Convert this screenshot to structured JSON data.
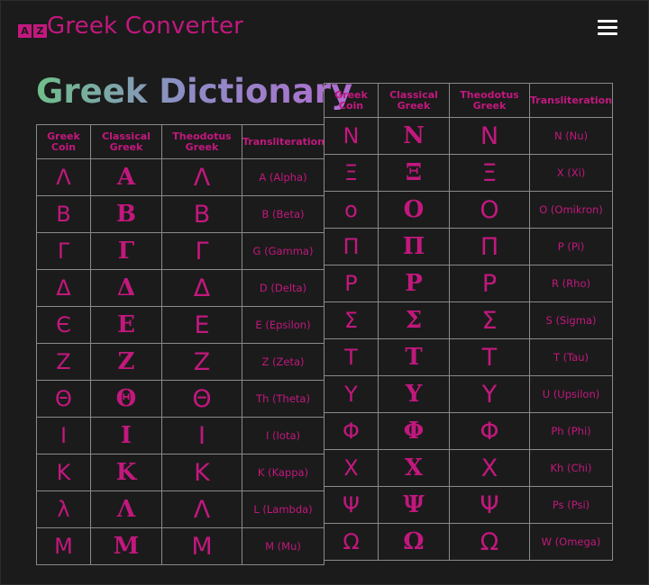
{
  "app": {
    "title": "Greek Converter",
    "logo_glyphs": [
      "A",
      "Ζ"
    ]
  },
  "menu_icon": "hamburger-menu-icon",
  "page": {
    "heading": "Greek Dictionary"
  },
  "colors": {
    "accent": "#c2187e",
    "background": "#1b1b1b",
    "border": "#8a8a8a"
  },
  "table": {
    "headers": [
      "Greek Coin",
      "Classical Greek",
      "Theodotus Greek",
      "Transliteration"
    ],
    "left_rows": [
      {
        "coin": "Λ",
        "classical": "Α",
        "theodotus": "Λ",
        "translit": "A (Alpha)"
      },
      {
        "coin": "Β",
        "classical": "Β",
        "theodotus": "Β",
        "translit": "B (Beta)"
      },
      {
        "coin": "Γ",
        "classical": "Γ",
        "theodotus": "Γ",
        "translit": "G (Gamma)"
      },
      {
        "coin": "Δ",
        "classical": "Δ",
        "theodotus": "Δ",
        "translit": "D (Delta)"
      },
      {
        "coin": "Є",
        "classical": "Ε",
        "theodotus": "Ε",
        "translit": "E (Epsilon)"
      },
      {
        "coin": "Ζ",
        "classical": "Ζ",
        "theodotus": "Ζ",
        "translit": "Z (Zeta)"
      },
      {
        "coin": "Θ",
        "classical": "Θ",
        "theodotus": "Θ",
        "translit": "Th (Theta)"
      },
      {
        "coin": "Ι",
        "classical": "Ι",
        "theodotus": "Ι",
        "translit": "I (Iota)"
      },
      {
        "coin": "Κ",
        "classical": "Κ",
        "theodotus": "Κ",
        "translit": "K (Kappa)"
      },
      {
        "coin": "λ",
        "classical": "Λ",
        "theodotus": "Λ",
        "translit": "L (Lambda)"
      },
      {
        "coin": "Μ",
        "classical": "Μ",
        "theodotus": "Μ",
        "translit": "M (Mu)"
      }
    ],
    "right_rows": [
      {
        "coin": "Ν",
        "classical": "Ν",
        "theodotus": "Ν",
        "translit": "N (Nu)"
      },
      {
        "coin": "Ξ",
        "classical": "Ξ",
        "theodotus": "Ξ",
        "translit": "X (Xi)"
      },
      {
        "coin": "ο",
        "classical": "Ο",
        "theodotus": "Ο",
        "translit": "O (Omikron)"
      },
      {
        "coin": "Π",
        "classical": "Π",
        "theodotus": "Π",
        "translit": "P (Pi)"
      },
      {
        "coin": "Ρ",
        "classical": "Ρ",
        "theodotus": "Ρ",
        "translit": "R (Rho)"
      },
      {
        "coin": "Σ",
        "classical": "Σ",
        "theodotus": "Σ",
        "translit": "S (Sigma)"
      },
      {
        "coin": "Τ",
        "classical": "Τ",
        "theodotus": "Τ",
        "translit": "T (Tau)"
      },
      {
        "coin": "Υ",
        "classical": "Υ",
        "theodotus": "Υ",
        "translit": "U (Upsilon)"
      },
      {
        "coin": "Φ",
        "classical": "Φ",
        "theodotus": "Φ",
        "translit": "Ph (Phi)"
      },
      {
        "coin": "Χ",
        "classical": "Χ",
        "theodotus": "Χ",
        "translit": "Kh (Chi)"
      },
      {
        "coin": "Ψ",
        "classical": "Ψ",
        "theodotus": "Ψ",
        "translit": "Ps (Psi)"
      },
      {
        "coin": "Ω",
        "classical": "Ω",
        "theodotus": "Ω",
        "translit": "W (Omega)"
      }
    ]
  }
}
